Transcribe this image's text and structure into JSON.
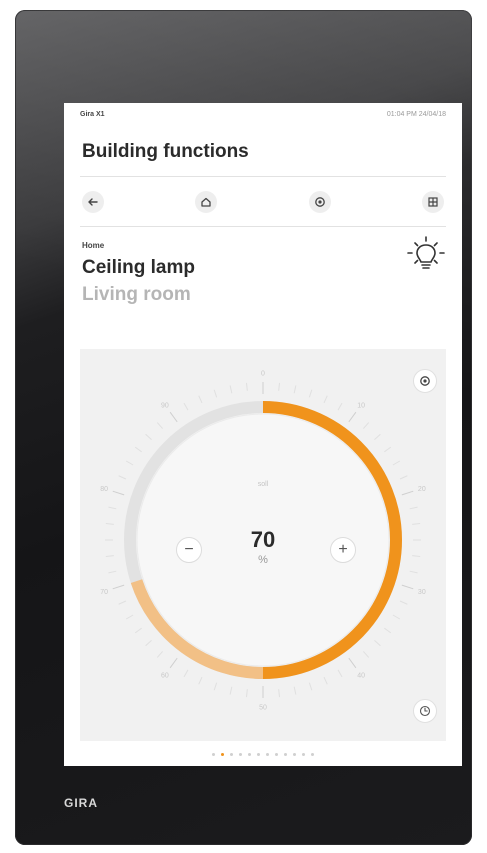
{
  "status_bar": {
    "app_name": "Gira X1",
    "datetime": "01:04 PM 24/04/18"
  },
  "page_title": "Building functions",
  "nav": {
    "buttons": [
      "back",
      "home",
      "settings",
      "grid"
    ]
  },
  "device": {
    "breadcrumb": "Home",
    "name": "Ceiling lamp",
    "room": "Living room",
    "icon": "lightbulb-icon"
  },
  "dimmer": {
    "value": "70",
    "unit": "%",
    "level_fraction": 0.7,
    "hint_text": "soll",
    "scale_labels": [
      "0",
      "10",
      "20",
      "30",
      "40",
      "50",
      "60",
      "70",
      "80",
      "90"
    ],
    "decrease_label": "−",
    "increase_label": "+"
  },
  "pager": {
    "count": 12,
    "active_index": 1
  },
  "brand": "GIRA",
  "colors": {
    "accent": "#f0931c",
    "accent_light": "#f2c086",
    "track": "#e2e2e2",
    "panel": "#f1f1f1",
    "text": "#2b2b2b",
    "muted": "#b5b5b5"
  }
}
